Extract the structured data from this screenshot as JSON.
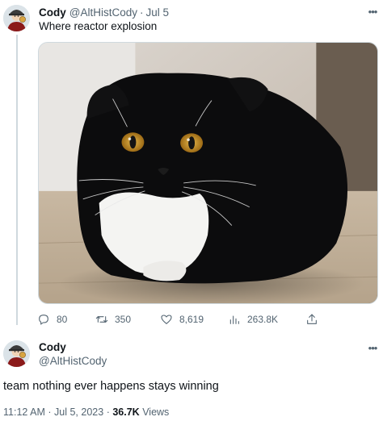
{
  "parent_tweet": {
    "author_name": "Cody",
    "author_handle": "@AltHistCody",
    "separator": "·",
    "date": "Jul 5",
    "text": "Where reactor explosion",
    "more_icon": "more-dots-icon",
    "image_subject": "cat-photo",
    "actions": {
      "replies": "80",
      "retweets": "350",
      "likes": "8,619",
      "views": "263.8K",
      "icons": [
        "reply-icon",
        "retweet-icon",
        "like-icon",
        "views-icon",
        "share-icon"
      ]
    }
  },
  "main_tweet": {
    "author_name": "Cody",
    "author_handle": "@AltHistCody",
    "text": "team nothing ever happens stays winning",
    "time": "11:12 AM",
    "separator": "·",
    "date": "Jul 5, 2023",
    "views_count": "36.7K",
    "views_label": "Views",
    "more_icon": "more-dots-icon"
  },
  "colors": {
    "text_primary": "#0f1419",
    "text_secondary": "#536471",
    "divider": "#cfd9de"
  }
}
